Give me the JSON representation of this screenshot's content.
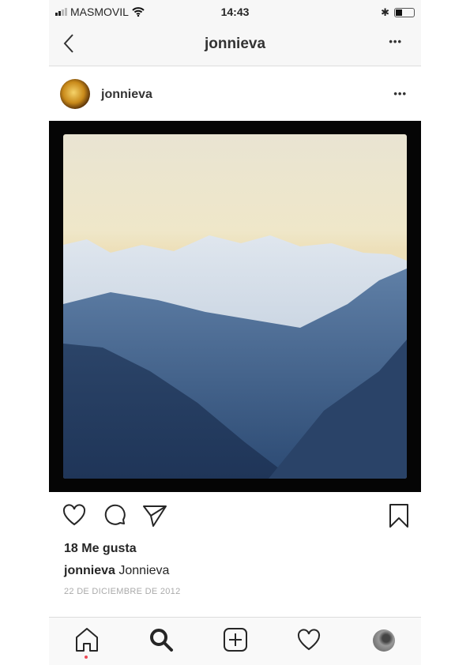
{
  "status_bar": {
    "carrier": "MASMOVIL",
    "time": "14:43"
  },
  "nav": {
    "title": "jonnieva",
    "more": "•••"
  },
  "post": {
    "username": "jonnieva",
    "more": "•••",
    "likes": "18 Me gusta",
    "caption_user": "jonnieva",
    "caption_text": "Jonnieva",
    "date": "22 DE DICIEMBRE DE 2012"
  },
  "icons": [
    "back-chevron",
    "heart",
    "comment",
    "share",
    "bookmark",
    "home",
    "search",
    "add",
    "activity-heart",
    "profile"
  ]
}
